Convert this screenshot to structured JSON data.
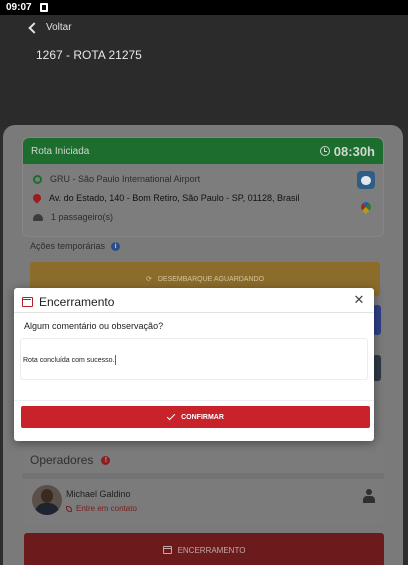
{
  "status_bar": {
    "time": "09:07"
  },
  "header": {
    "back_label": "Voltar",
    "route_title": "1267 - ROTA 21275"
  },
  "route_card": {
    "status": "Rota Iniciada",
    "time": "08:30h",
    "origin": "GRU - São Paulo International Airport",
    "destination": "Av. do Estado, 140 - Bom Retiro, São Paulo - SP, 01128, Brasil",
    "passengers": "1 passageiro(s)"
  },
  "temporary_actions": {
    "title": "Ações temporárias",
    "desembarque_label": "DESEMBARQUE AGUARDANDO"
  },
  "operadores": {
    "title": "Operadores",
    "operator": {
      "name": "Michael Galdino",
      "contact_label": "Entre em contato"
    }
  },
  "encerramento_button": "ENCERRAMENTO",
  "modal": {
    "title": "Encerramento",
    "question": "Algum comentário ou observação?",
    "comment_value": "Rota concluída com sucesso.",
    "confirm_label": "CONFIRMAR"
  },
  "colors": {
    "route_green": "#1c6d2e",
    "accent_red": "#c8232b",
    "warning_orange": "#f0a81d"
  }
}
